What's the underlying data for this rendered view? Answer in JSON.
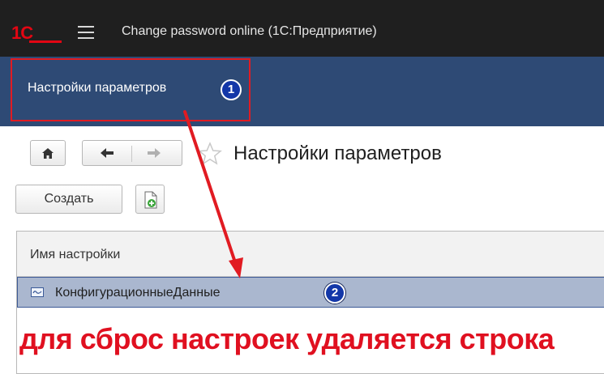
{
  "titlebar": {
    "logo_text": "1С",
    "logo_color": "#e30613",
    "app_title": "Change password online  (1С:Предприятие)"
  },
  "section": {
    "item_label": "Настройки параметров",
    "badge": "1"
  },
  "toolbar": {
    "home_icon": "home-icon",
    "back_icon": "arrow-left-icon",
    "forward_icon": "arrow-right-icon",
    "favorite_icon": "star-icon",
    "page_title": "Настройки параметров",
    "create_label": "Создать",
    "add_doc_icon": "document-add-icon"
  },
  "table": {
    "column_header": "Имя настройки",
    "rows": [
      {
        "label": "КонфигурационныеДанные",
        "icon": "setting-row-icon",
        "badge": "2"
      }
    ]
  },
  "annotation": {
    "text": "для сброс настроек удаляется строка",
    "color": "#e01020"
  },
  "colors": {
    "titlebar_bg": "#1f1f1f",
    "sectionbar_bg": "#2e4a75",
    "selected_row_bg": "#aab7cf",
    "highlight_red": "#e11b22",
    "badge_blue": "#1337a8"
  }
}
